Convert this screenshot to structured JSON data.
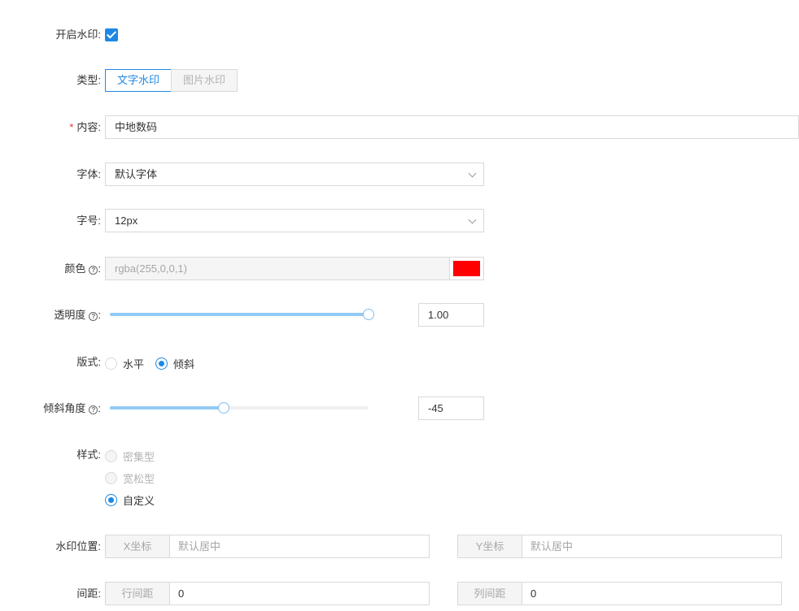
{
  "form": {
    "enable_watermark": {
      "label": "开启水印:",
      "checked": true
    },
    "type": {
      "label": "类型:",
      "options": [
        "文字水印",
        "图片水印"
      ],
      "selected": "文字水印"
    },
    "content": {
      "required_mark": "*",
      "label": "内容:",
      "value": "中地数码"
    },
    "font": {
      "label": "字体:",
      "value": "默认字体"
    },
    "font_size": {
      "label": "字号:",
      "value": "12px"
    },
    "color": {
      "label": "颜色",
      "value": "rgba(255,0,0,1)",
      "swatch": "#ff0000"
    },
    "opacity": {
      "label": "透明度",
      "value": "1.00",
      "fraction": 1.0
    },
    "layout": {
      "label": "版式:",
      "options": [
        "水平",
        "倾斜"
      ],
      "selected": "倾斜"
    },
    "tilt_angle": {
      "label": "倾斜角度",
      "value": "-45",
      "fraction": 0.44
    },
    "style": {
      "label": "样式:",
      "options": [
        "密集型",
        "宽松型",
        "自定义"
      ],
      "selected": "自定义"
    },
    "position": {
      "label": "水印位置:",
      "x_label": "X坐标",
      "x_placeholder": "默认居中",
      "y_label": "Y坐标",
      "y_placeholder": "默认居中"
    },
    "spacing": {
      "label": "间距:",
      "row_label": "行间距",
      "row_value": "0",
      "col_label": "列间距",
      "col_value": "0"
    }
  },
  "colors": {
    "accent": "#1e88e5",
    "slider_track": "#91caf4",
    "required": "#e4393c"
  }
}
